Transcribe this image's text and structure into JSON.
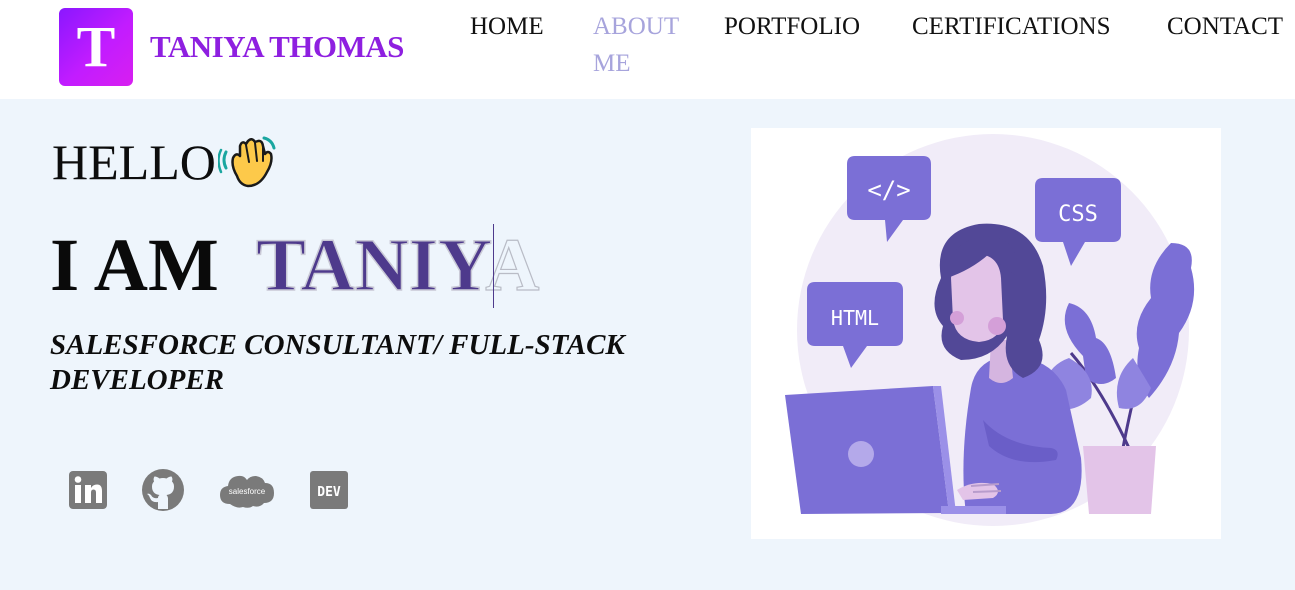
{
  "brand": {
    "logo_letter": "T",
    "name": "TANIYA THOMAS"
  },
  "nav": [
    {
      "label": "HOME",
      "active": false
    },
    {
      "label": "ABOUT ME",
      "active": true
    },
    {
      "label": "PORTFOLIO",
      "active": false
    },
    {
      "label": "CERTIFICATIONS",
      "active": false
    },
    {
      "label": "CONTACT",
      "active": false
    }
  ],
  "hero": {
    "greeting": "HELLO",
    "greeting_icon": "waving-hand-icon",
    "intro": "I AM",
    "typed_name_visible": "TANIY",
    "typed_name_ghost": "A",
    "role": "SALESFORCE CONSULTANT/ FULL-STACK DEVELOPER"
  },
  "social": [
    {
      "icon": "linkedin-icon"
    },
    {
      "icon": "github-icon"
    },
    {
      "icon": "salesforce-icon",
      "text": "salesforce"
    },
    {
      "icon": "dev-icon",
      "text": "DEV"
    }
  ],
  "illustration": {
    "bubbles": [
      "</>",
      "CSS",
      "HTML"
    ]
  },
  "colors": {
    "brand": "#8e1fe0",
    "accent": "#4e3a8c",
    "nav_active": "#a7a4dc",
    "hero_bg": "#eef5fc",
    "icon_gray": "#7a7a7a",
    "illustration_purple": "#7b6fd6"
  }
}
